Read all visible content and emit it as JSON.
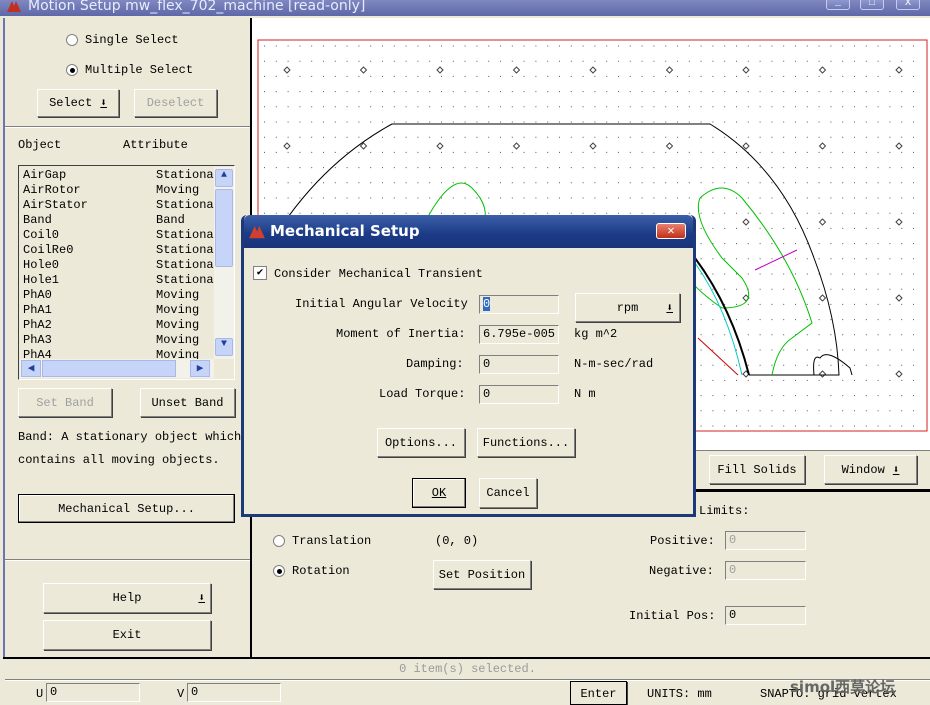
{
  "window": {
    "title": "Motion Setup  mw_flex_702_machine  [read-only]",
    "minimize": "_",
    "maximize": "□",
    "close": "X"
  },
  "left": {
    "single_select": "Single Select",
    "multiple_select": "Multiple Select",
    "selection_mode": "multiple",
    "select_button": "Select",
    "deselect_button": "Deselect",
    "columns": [
      "Object",
      "Attribute"
    ],
    "objects": [
      {
        "name": "AirGap",
        "attr": "Stationa"
      },
      {
        "name": "AirRotor",
        "attr": "Moving"
      },
      {
        "name": "AirStator",
        "attr": "Stationa"
      },
      {
        "name": "Band",
        "attr": "Band"
      },
      {
        "name": "Coil0",
        "attr": "Stationa"
      },
      {
        "name": "CoilRe0",
        "attr": "Stationa"
      },
      {
        "name": "Hole0",
        "attr": "Stationa"
      },
      {
        "name": "Hole1",
        "attr": "Stationa"
      },
      {
        "name": "PhA0",
        "attr": "Moving"
      },
      {
        "name": "PhA1",
        "attr": "Moving"
      },
      {
        "name": "PhA2",
        "attr": "Moving"
      },
      {
        "name": "PhA3",
        "attr": "Moving"
      },
      {
        "name": "PhA4",
        "attr": "Moving"
      }
    ],
    "set_band": "Set Band",
    "unset_band": "Unset Band",
    "band_desc_1": "Band: A stationary object which",
    "band_desc_2": "contains all moving objects.",
    "mechanical_setup": "Mechanical Setup...",
    "help": "Help",
    "exit": "Exit"
  },
  "canvas": {
    "fill_solids": "Fill Solids",
    "window": "Window",
    "colors": {
      "border": "#d02020",
      "outline": "#000000",
      "coil": "#00c000",
      "band": "#00c8c8",
      "magnet": "#d00000",
      "line": "#c000c0"
    }
  },
  "motion": {
    "limits": "Limits:",
    "translation": "Translation",
    "rotation": "Rotation",
    "motion_type": "rotation",
    "position": "(0, 0)",
    "set_position": "Set Position",
    "positive_label": "Positive:",
    "positive": "0",
    "negative_label": "Negative:",
    "negative": "0",
    "initial_pos_label": "Initial Pos:",
    "initial_pos": "0"
  },
  "status": {
    "message": "0 item(s) selected.",
    "u_label": "U",
    "u": "0",
    "v_label": "V",
    "v": "0",
    "enter": "Enter",
    "units": "UNITS: mm",
    "snap": "SNAPTO: grid vertex",
    "watermark": "simol西莫论坛"
  },
  "dialog": {
    "title": "Mechanical Setup",
    "consider": "Consider Mechanical Transient",
    "consider_checked": true,
    "velocity_label": "Initial Angular Velocity",
    "velocity": "0",
    "velocity_unit": "rpm",
    "inertia_label": "Moment of Inertia:",
    "inertia": "6.795e-005",
    "inertia_unit": "kg m^2",
    "damping_label": "Damping:",
    "damping": "0",
    "damping_unit": "N-m-sec/rad",
    "torque_label": "Load Torque:",
    "torque": "0",
    "torque_unit": "N m",
    "options": "Options...",
    "functions": "Functions...",
    "ok": "OK",
    "cancel": "Cancel"
  }
}
